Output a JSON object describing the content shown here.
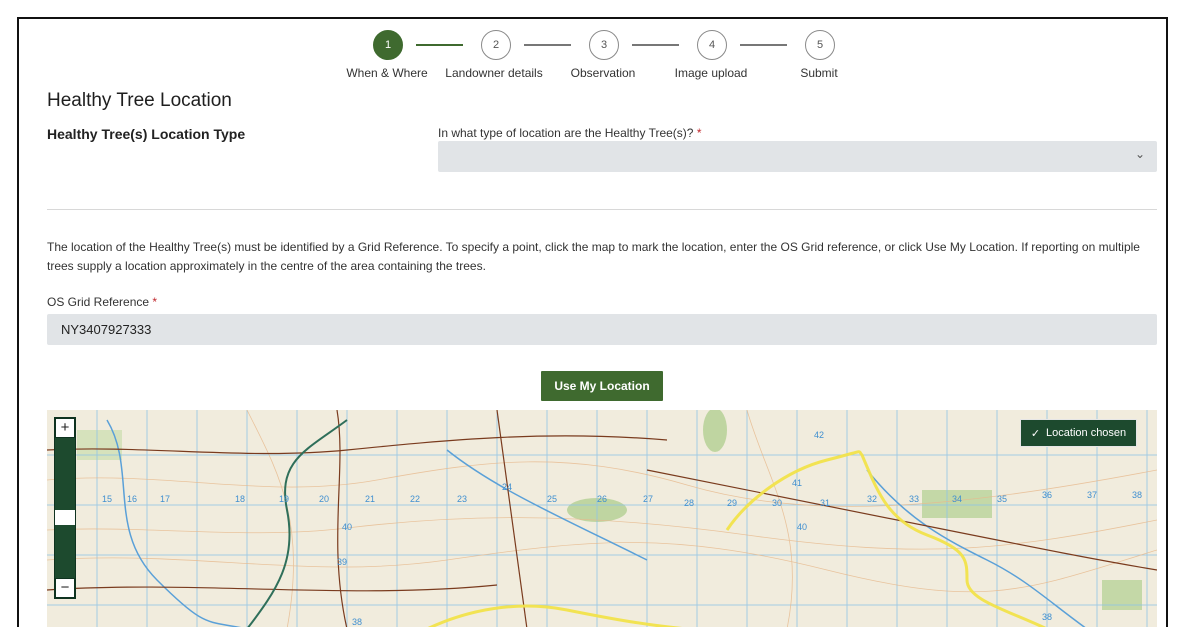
{
  "stepper": {
    "steps": [
      {
        "number": "1",
        "label": "When & Where",
        "state": "active"
      },
      {
        "number": "2",
        "label": "Landowner details",
        "state": "pending"
      },
      {
        "number": "3",
        "label": "Observation",
        "state": "pending"
      },
      {
        "number": "4",
        "label": "Image upload",
        "state": "pending"
      },
      {
        "number": "5",
        "label": "Submit",
        "state": "pending"
      }
    ]
  },
  "section": {
    "title": "Healthy Tree Location",
    "location_type_label": "Healthy Tree(s) Location Type",
    "location_type_question": "In what type of location are the Healthy Tree(s)?",
    "location_type_value": "",
    "required_mark": "*",
    "info_text": "The location of the Healthy Tree(s) must be identified by a Grid Reference. To specify a point, click the map to mark the location, enter the OS Grid reference, or click Use My Location. If reporting on multiple trees supply a location approximately in the centre of the area containing the trees."
  },
  "grid_ref": {
    "label": "OS Grid Reference",
    "value": "NY3407927333"
  },
  "buttons": {
    "use_my_location": "Use My Location"
  },
  "map": {
    "zoom_in": "+",
    "zoom_out": "−",
    "location_chosen": "Location chosen",
    "grid_numbers_top": [
      "15",
      "16",
      "17",
      "18",
      "19",
      "20",
      "21",
      "22",
      "23",
      "24",
      "25",
      "26",
      "27",
      "28",
      "29",
      "30",
      "31",
      "32",
      "33",
      "34",
      "35",
      "36",
      "37",
      "38"
    ],
    "grid_numbers_row2": [
      "39",
      "40",
      "41",
      "42"
    ],
    "grid_number_bottom": "38"
  },
  "colors": {
    "primary_green": "#3f6a2f",
    "dark_green": "#1d4a2e",
    "field_bg": "#e1e4e7",
    "required_red": "#c0282d"
  }
}
